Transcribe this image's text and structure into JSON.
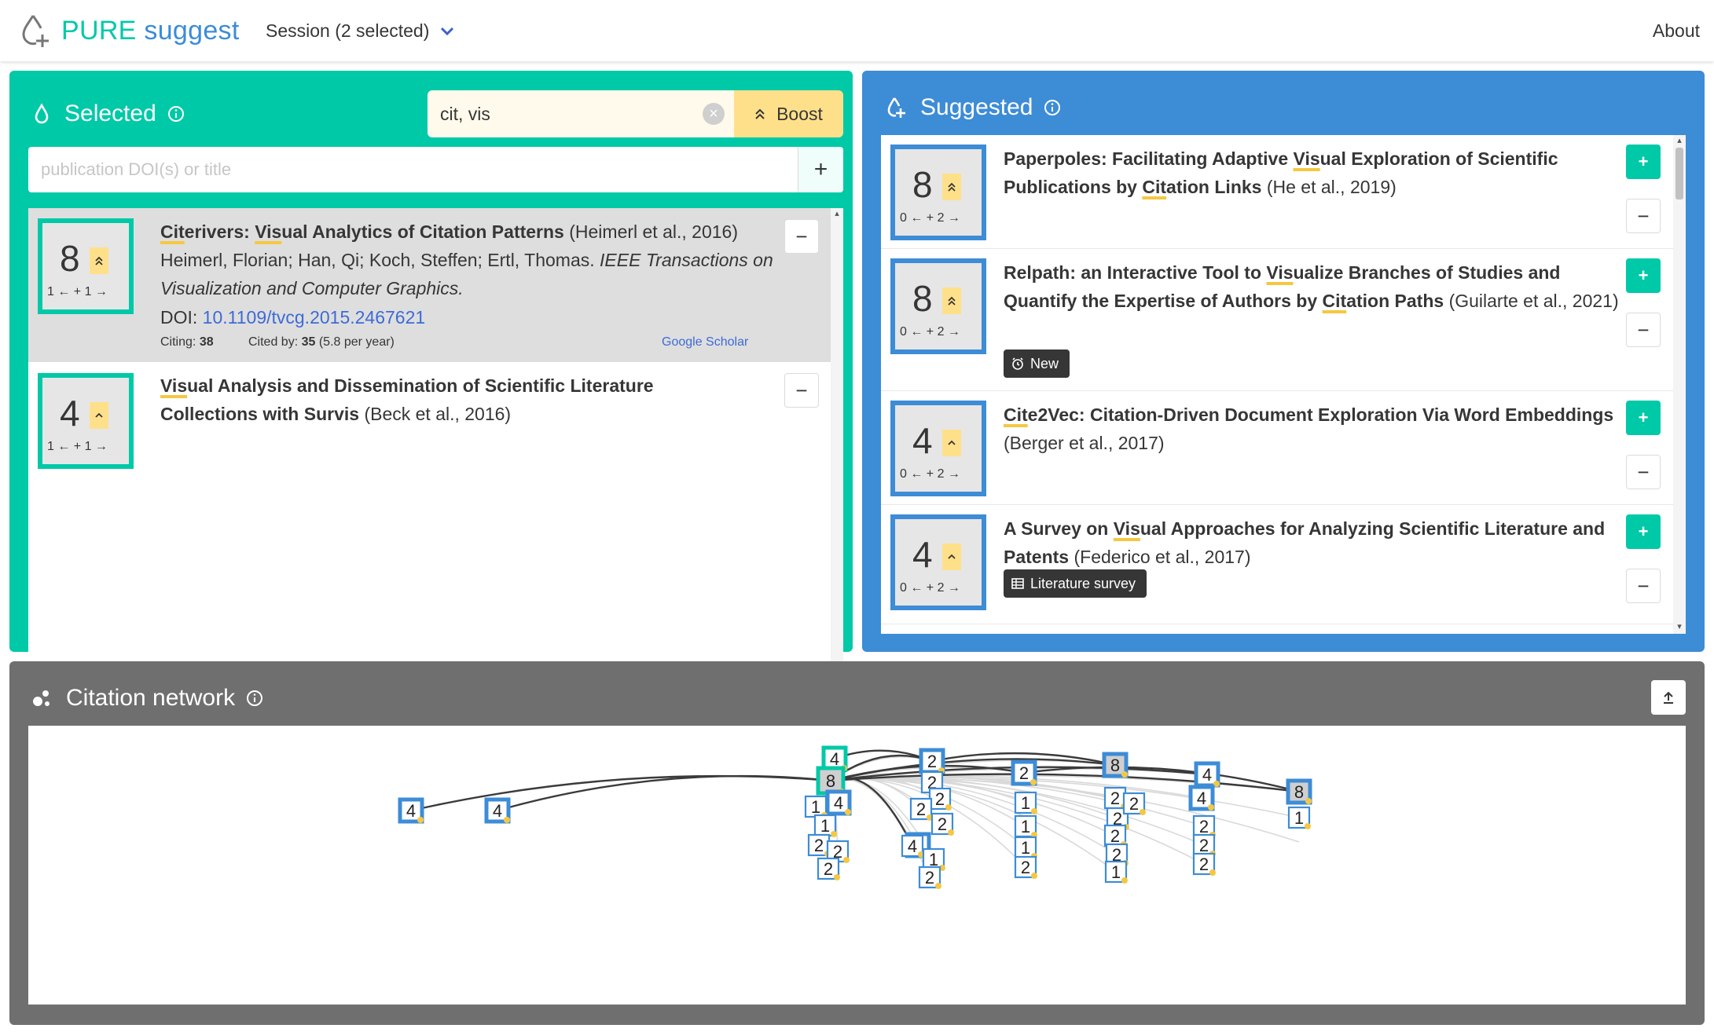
{
  "app": {
    "name_part1": "PURE",
    "name_part2": "suggest",
    "session_label": "Session (2 selected)",
    "about_label": "About",
    "colors": {
      "teal": "#00c9a7",
      "blue": "#3d8cd6",
      "gray": "#6f6f6f",
      "boost_yellow": "#ffe08a"
    }
  },
  "selected_panel": {
    "title": "Selected",
    "boost_value": "cit, vis",
    "boost_label": "Boost",
    "add_placeholder": "publication DOI(s) or title",
    "add_label": "+",
    "items": [
      {
        "score": "8",
        "citations": "1 ← + 1 →",
        "title_pre": "",
        "title_u1": "Cit",
        "title_mid1": "erivers: ",
        "title_u2": "Vis",
        "title_rest": "ual Analytics of Citation Patterns",
        "meta": "(Heimerl et al., 2016)",
        "authors": "Heimerl, Florian; Han, Qi; Koch, Steffen; Ertl, Thomas.",
        "venue": "IEEE Transactions on Visualization and Computer Graphics.",
        "doi_label": "DOI:",
        "doi": "10.1109/tvcg.2015.2467621",
        "citing_label": "Citing:",
        "citing": "38",
        "cited_label": "Cited by:",
        "cited": "35",
        "per_year": "(5.8 per year)",
        "scholar": "Google Scholar",
        "remove_label": "−"
      },
      {
        "score": "4",
        "citations": "1 ← + 1 →",
        "title_u1": "Vis",
        "title_rest": "ual Analysis and Dissemination of Scientific Literature Collections with Survis",
        "meta": "(Beck et al., 2016)",
        "remove_label": "−"
      }
    ]
  },
  "suggested_panel": {
    "title": "Suggested",
    "items": [
      {
        "score": "8",
        "citations": "0 ← + 2 →",
        "t1": "Paperpoles: Facilitating Adaptive ",
        "u1": "Vis",
        "t2": "ual Exploration of Scientific Publications by ",
        "u2": "Cit",
        "t3": "ation Links",
        "meta": "(He et al., 2019)",
        "add_label": "+",
        "remove_label": "−"
      },
      {
        "score": "8",
        "citations": "0 ← + 2 →",
        "t1": "Relpath: an Interactive Tool to ",
        "u1": "Vis",
        "t2": "ualize Branches of Studies and Quantify the Expertise of Authors by ",
        "u2": "Cit",
        "t3": "ation Paths",
        "meta": "(Guilarte et al., 2021)",
        "tag": "New",
        "add_label": "+",
        "remove_label": "−"
      },
      {
        "score": "4",
        "citations": "0 ← + 2 →",
        "u1": "Cit",
        "t2": "e2Vec: Citation-Driven Document Exploration Via Word Embeddings",
        "meta": "(Berger et al., 2017)",
        "add_label": "+",
        "remove_label": "−"
      },
      {
        "score": "4",
        "citations": "0 ← + 2 →",
        "t1": "A Survey on ",
        "u1": "Vis",
        "t2": "ual Approaches for Analyzing Scientific Literature and Patents",
        "meta": "(Federico et al., 2017)",
        "tag": "Literature survey",
        "add_label": "+",
        "remove_label": "−"
      }
    ]
  },
  "network_panel": {
    "title": "Citation network",
    "nodes": [
      {
        "label": "4",
        "kind": "sel"
      },
      {
        "label": "8",
        "kind": "sel"
      },
      {
        "label": "4",
        "kind": "sug"
      },
      {
        "label": "4",
        "kind": "sug"
      },
      {
        "label": "4",
        "kind": "sug"
      },
      {
        "label": "2",
        "kind": "sug"
      },
      {
        "label": "2",
        "kind": "sug"
      },
      {
        "label": "8",
        "kind": "sug"
      },
      {
        "label": "4",
        "kind": "sug"
      },
      {
        "label": "8",
        "kind": "sug"
      },
      {
        "label": "1",
        "kind": "cand"
      },
      {
        "label": "4",
        "kind": "sug"
      },
      {
        "label": "1",
        "kind": "cand"
      },
      {
        "label": "2",
        "kind": "cand"
      },
      {
        "label": "2",
        "kind": "cand"
      },
      {
        "label": "2",
        "kind": "cand"
      },
      {
        "label": "2",
        "kind": "cand"
      },
      {
        "label": "2",
        "kind": "cand"
      },
      {
        "label": "2",
        "kind": "cand"
      },
      {
        "label": "2",
        "kind": "cand"
      },
      {
        "label": "4",
        "kind": "sug"
      },
      {
        "label": "4",
        "kind": "cand"
      },
      {
        "label": "1",
        "kind": "cand"
      },
      {
        "label": "2",
        "kind": "cand"
      },
      {
        "label": "1",
        "kind": "cand"
      },
      {
        "label": "1",
        "kind": "cand"
      },
      {
        "label": "1",
        "kind": "cand"
      },
      {
        "label": "2",
        "kind": "cand"
      },
      {
        "label": "2",
        "kind": "cand"
      },
      {
        "label": "2",
        "kind": "cand"
      },
      {
        "label": "2",
        "kind": "cand"
      },
      {
        "label": "2",
        "kind": "cand"
      },
      {
        "label": "1",
        "kind": "cand"
      },
      {
        "label": "2",
        "kind": "cand"
      },
      {
        "label": "2",
        "kind": "cand"
      },
      {
        "label": "2",
        "kind": "cand"
      },
      {
        "label": "2",
        "kind": "cand"
      },
      {
        "label": "1",
        "kind": "cand"
      }
    ]
  }
}
